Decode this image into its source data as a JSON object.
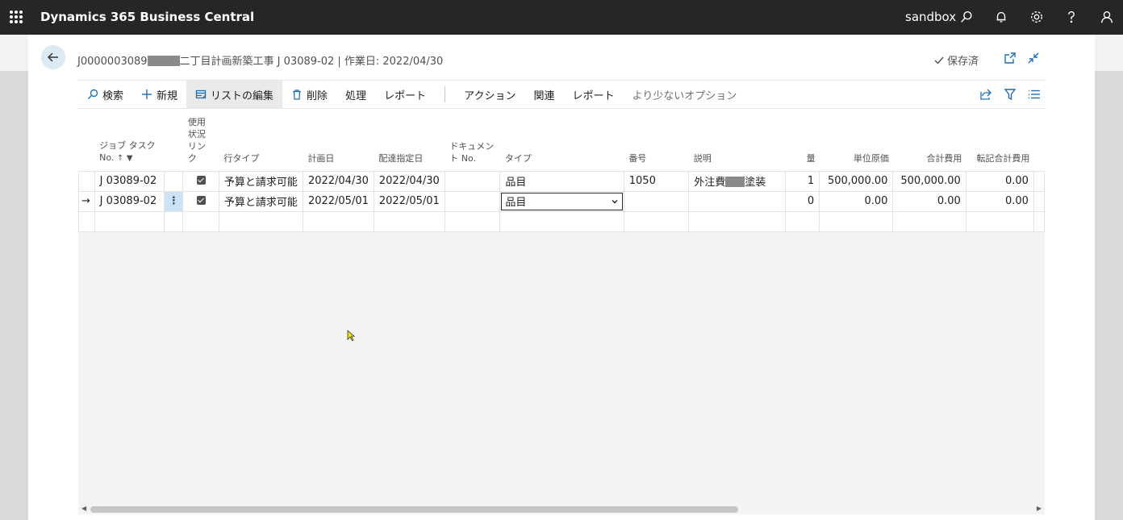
{
  "topbar": {
    "app_title": "Dynamics 365 Business Central",
    "environment": "sandbox"
  },
  "header": {
    "title_prefix": "J0000003089",
    "title_suffix": "二丁目計画新築工事 J 03089-02 | 作業日: 2022/04/30",
    "saved_label": "保存済"
  },
  "actions": {
    "search": "検索",
    "new": "新規",
    "edit_list": "リストの編集",
    "delete": "削除",
    "process": "処理",
    "report": "レポート",
    "action": "アクション",
    "related": "関連",
    "report2": "レポート",
    "fewer_options": "より少ないオプション"
  },
  "columns": {
    "job_task_no": "ジョブ タスク No.",
    "usage_link": "使用状況リンク",
    "line_type": "行タイプ",
    "planning_date": "計画日",
    "planned_delivery": "配達指定日",
    "document_no": "ドキュメント No.",
    "type": "タイプ",
    "no": "番号",
    "description": "説明",
    "quantity": "量",
    "unit_cost": "単位原価",
    "total_cost": "合計費用",
    "total_cost_lcy": "転記合計費用"
  },
  "rows": [
    {
      "job_task_no": "J 03089-02",
      "usage_link": true,
      "line_type": "予算と請求可能",
      "planning_date": "2022/04/30",
      "planned_delivery": "2022/04/30",
      "document_no": "",
      "type": "品目",
      "no": "1050",
      "desc_a": "外注費",
      "desc_b": "塗装",
      "quantity": "1",
      "unit_cost": "500,000.00",
      "total_cost": "500,000.00",
      "total_cost_lcy": "0.00"
    },
    {
      "job_task_no": "J 03089-02",
      "usage_link": true,
      "line_type": "予算と請求可能",
      "planning_date": "2022/05/01",
      "planned_delivery": "2022/05/01",
      "document_no": "",
      "type": "品目",
      "no": "",
      "desc_a": "",
      "desc_b": "",
      "quantity": "0",
      "unit_cost": "0.00",
      "total_cost": "0.00",
      "total_cost_lcy": "0.00"
    }
  ]
}
